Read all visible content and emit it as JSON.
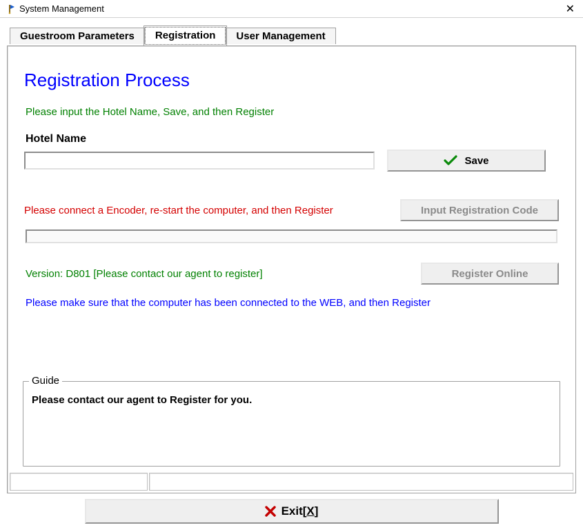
{
  "window": {
    "title": "System Management"
  },
  "tabs": {
    "t0": "Guestroom Parameters",
    "t1": "Registration",
    "t2": "User Management",
    "active": 1
  },
  "reg": {
    "heading": "Registration Process",
    "instruction": "Please input the Hotel Name, Save, and then Register",
    "hotel_label": "Hotel Name",
    "hotel_value": "",
    "save_label": "Save",
    "encoder_warning": "Please connect a Encoder, re-start the computer, and then Register",
    "input_code_label": "Input Registration Code",
    "version_line": "Version: D801   [Please contact our agent to register]",
    "register_online_label": "Register Online",
    "web_note": "Please make sure that the computer has been connected to the WEB, and then Register"
  },
  "guide": {
    "legend": "Guide",
    "text": "Please contact our agent to Register for you."
  },
  "exit": {
    "label_prefix": "Exit[",
    "label_hotkey": "X",
    "label_suffix": "]"
  },
  "colors": {
    "link_blue": "#0000ff",
    "ok_green": "#008000",
    "error_red": "#d40000"
  }
}
